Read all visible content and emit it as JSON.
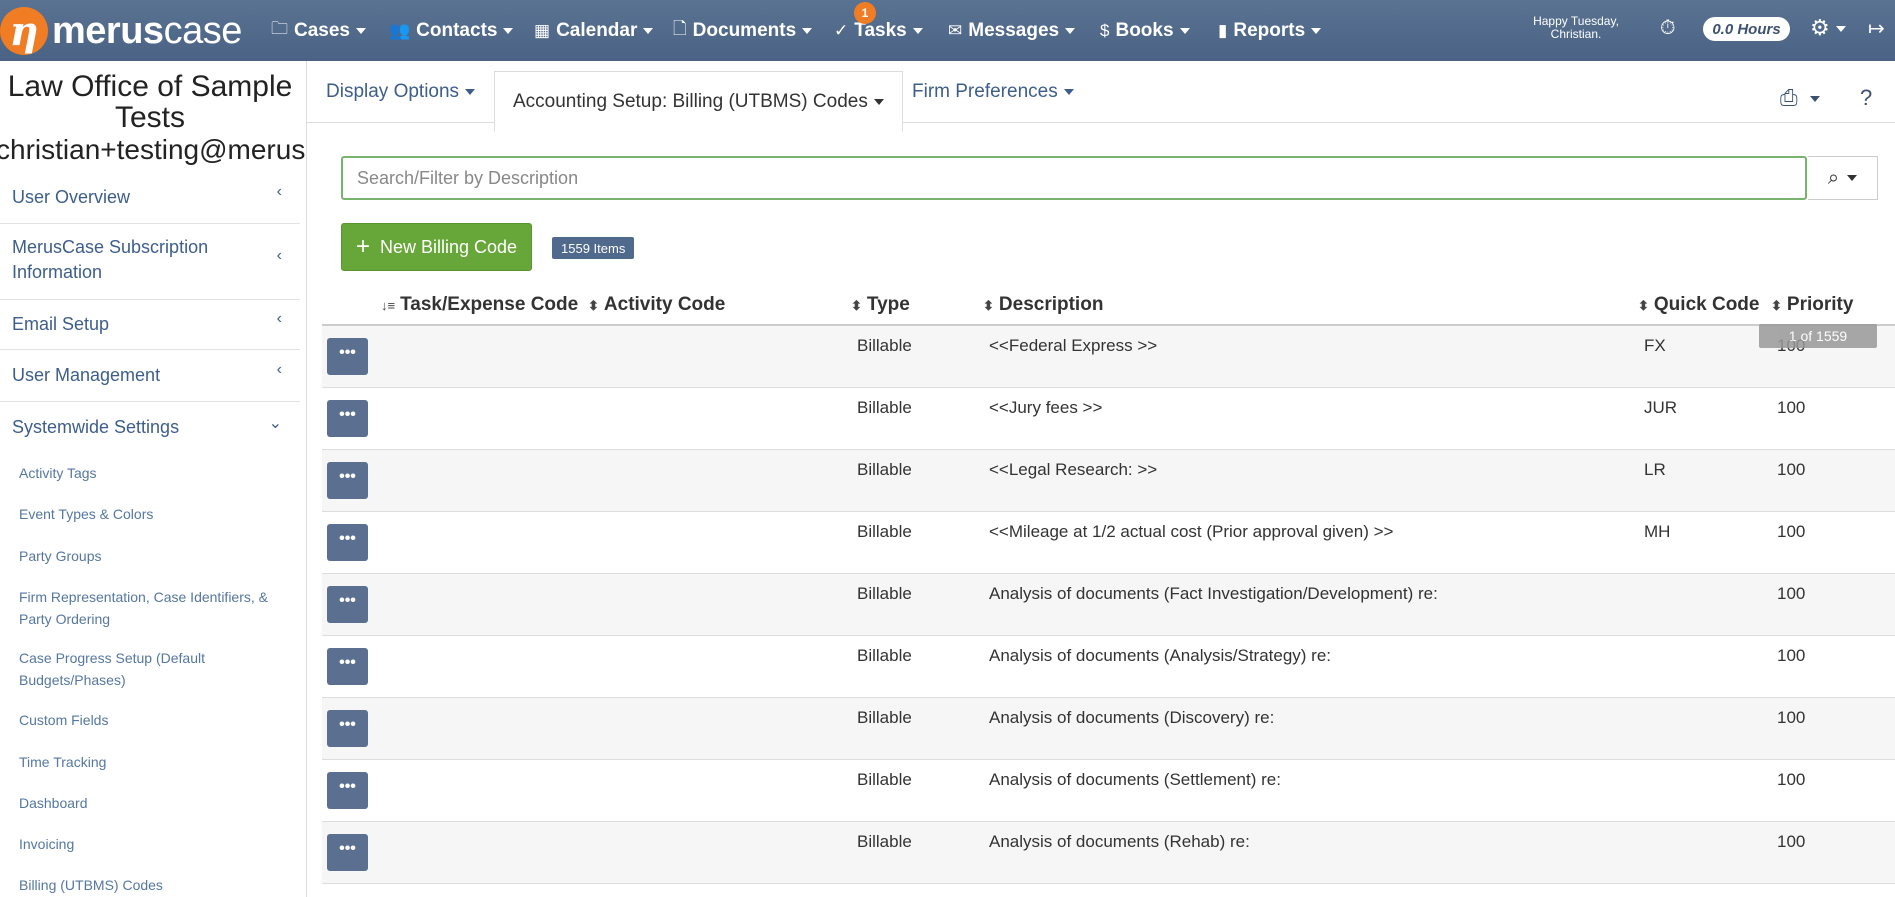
{
  "app": {
    "logo_bold": "merus",
    "logo_light": "case",
    "nav": [
      {
        "label": "Cases",
        "icon": "folder-icon"
      },
      {
        "label": "Contacts",
        "icon": "users-icon"
      },
      {
        "label": "Calendar",
        "icon": "calendar-icon"
      },
      {
        "label": "Documents",
        "icon": "document-icon"
      },
      {
        "label": "Tasks",
        "icon": "check-circle-icon",
        "badge": "1"
      },
      {
        "label": "Messages",
        "icon": "envelope-icon"
      },
      {
        "label": "Books",
        "icon": "dollar-circle-icon"
      },
      {
        "label": "Reports",
        "icon": "bar-chart-icon"
      }
    ],
    "greeting_line1": "Happy Tuesday,",
    "greeting_line2": "Christian.",
    "hours": "0.0 Hours"
  },
  "sidebar": {
    "org_name": "Law Office of Sample Tests",
    "email": "christian+testing@meruscase.com",
    "items": [
      {
        "label": "User Overview"
      },
      {
        "label": "MerusCase Subscription Information"
      },
      {
        "label": "Email Setup"
      },
      {
        "label": "User Management"
      },
      {
        "label": "Systemwide Settings"
      }
    ],
    "subitems": [
      "Activity Tags",
      "Event Types & Colors",
      "Party Groups",
      "Firm Representation, Case Identifiers, & Party Ordering",
      "Case Progress Setup (Default Budgets/Phases)",
      "Custom Fields",
      "Time Tracking",
      "Dashboard",
      "Invoicing",
      "Billing (UTBMS) Codes"
    ]
  },
  "tabs": {
    "display_options": "Display Options",
    "accounting_setup": "Accounting Setup: Billing (UTBMS) Codes",
    "firm_preferences": "Firm Preferences"
  },
  "search": {
    "placeholder": "Search/Filter by Description"
  },
  "toolbar": {
    "new_button": "New Billing Code",
    "items_count": "1559 Items"
  },
  "table": {
    "columns": {
      "task_expense": "Task/Expense Code",
      "activity": "Activity Code",
      "type": "Type",
      "description": "Description",
      "quick_code": "Quick Code",
      "priority": "Priority"
    },
    "pager_tip": "1 of 1559",
    "more_label": "•••",
    "rows": [
      {
        "type": "Billable",
        "description": "<<Federal Express >>",
        "quick_code": "FX",
        "priority": "100"
      },
      {
        "type": "Billable",
        "description": "<<Jury fees >>",
        "quick_code": "JUR",
        "priority": "100"
      },
      {
        "type": "Billable",
        "description": "<<Legal Research: >>",
        "quick_code": "LR",
        "priority": "100"
      },
      {
        "type": "Billable",
        "description": "<<Mileage at 1/2 actual cost (Prior approval given) >>",
        "quick_code": "MH",
        "priority": "100"
      },
      {
        "type": "Billable",
        "description": "Analysis of documents (Fact Investigation/Development) re:",
        "quick_code": "",
        "priority": "100"
      },
      {
        "type": "Billable",
        "description": "Analysis of documents (Analysis/Strategy) re:",
        "quick_code": "",
        "priority": "100"
      },
      {
        "type": "Billable",
        "description": "Analysis of documents (Discovery) re:",
        "quick_code": "",
        "priority": "100"
      },
      {
        "type": "Billable",
        "description": "Analysis of documents (Settlement) re:",
        "quick_code": "",
        "priority": "100"
      },
      {
        "type": "Billable",
        "description": "Analysis of documents (Rehab) re:",
        "quick_code": "",
        "priority": "100"
      }
    ]
  }
}
